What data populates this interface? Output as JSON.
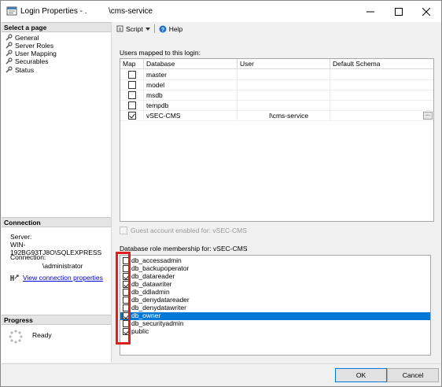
{
  "window": {
    "title_left": "Login Properties - .",
    "title_right": "\\cms-service"
  },
  "left": {
    "select_page_header": "Select a page",
    "pages": [
      {
        "label": "General"
      },
      {
        "label": "Server Roles"
      },
      {
        "label": "User Mapping"
      },
      {
        "label": "Securables"
      },
      {
        "label": "Status"
      }
    ],
    "connection_header": "Connection",
    "server_label": "Server:",
    "server_value": "WIN-192BG93TJ8O\\SQLEXPRESS",
    "connection_label": "Connection:",
    "connection_value": "\\administrator",
    "view_connection_link": "View connection properties",
    "progress_header": "Progress",
    "progress_status": "Ready"
  },
  "toolbar": {
    "script_label": "Script",
    "help_label": "Help"
  },
  "mapping": {
    "caption": "Users mapped to this login:",
    "columns": [
      "Map",
      "Database",
      "User",
      "Default Schema"
    ],
    "rows": [
      {
        "checked": false,
        "database": "master",
        "user": "",
        "schema": ""
      },
      {
        "checked": false,
        "database": "model",
        "user": "",
        "schema": ""
      },
      {
        "checked": false,
        "database": "msdb",
        "user": "",
        "schema": ""
      },
      {
        "checked": false,
        "database": "tempdb",
        "user": "",
        "schema": ""
      },
      {
        "checked": true,
        "database": "vSEC-CMS",
        "user": "I\\cms-service",
        "schema": ""
      }
    ],
    "ellipsis": "..."
  },
  "guest": {
    "label": "Guest account enabled for: vSEC-CMS",
    "enabled": false
  },
  "roles": {
    "caption": "Database role membership for: vSEC-CMS",
    "items": [
      {
        "label": "db_accessadmin",
        "checked": false,
        "selected": false
      },
      {
        "label": "db_backupoperator",
        "checked": false,
        "selected": false
      },
      {
        "label": "db_datareader",
        "checked": true,
        "selected": false
      },
      {
        "label": "db_datawriter",
        "checked": true,
        "selected": false
      },
      {
        "label": "db_ddladmin",
        "checked": false,
        "selected": false
      },
      {
        "label": "db_denydatareader",
        "checked": false,
        "selected": false
      },
      {
        "label": "db_denydatawriter",
        "checked": false,
        "selected": false
      },
      {
        "label": "db_owner",
        "checked": true,
        "selected": true
      },
      {
        "label": "db_securityadmin",
        "checked": false,
        "selected": false
      },
      {
        "label": "public",
        "checked": true,
        "selected": false
      }
    ]
  },
  "buttons": {
    "ok": "OK",
    "cancel": "Cancel"
  },
  "colors": {
    "selection": "#0078d7",
    "highlight_box": "#e01e1e",
    "link": "#0000e0"
  }
}
